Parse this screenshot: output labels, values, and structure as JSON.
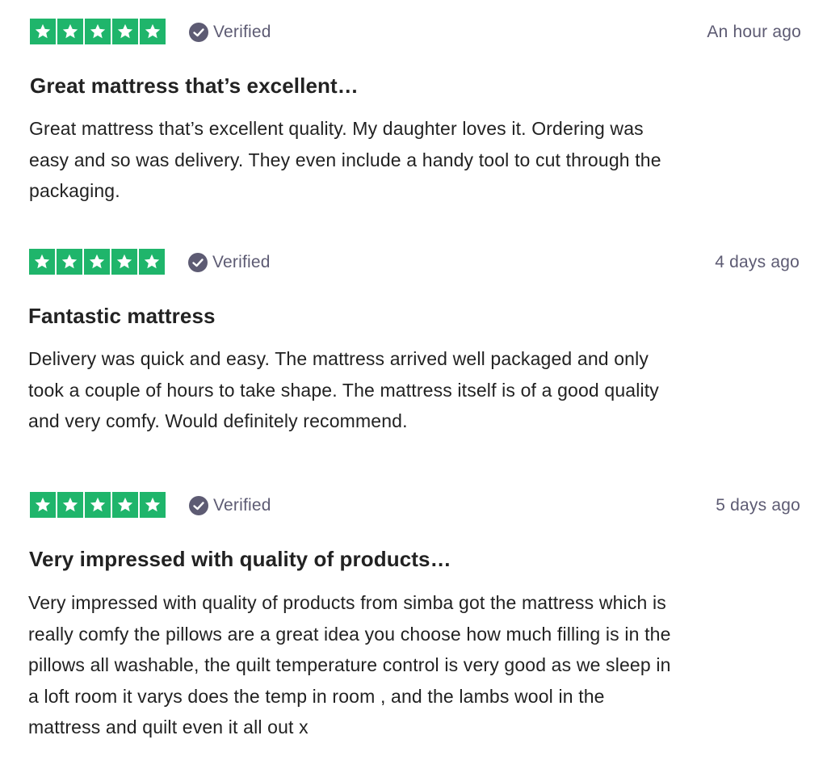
{
  "reviews": [
    {
      "rating": 5,
      "verified_label": "Verified",
      "time": "An hour ago",
      "title": "Great mattress that’s excellent…",
      "body_lines": [
        "Great mattress that’s excellent quality. My daughter loves it. Ordering was",
        "easy and so was delivery. They even include a handy tool to cut through the",
        "packaging."
      ]
    },
    {
      "rating": 5,
      "verified_label": "Verified",
      "time": "4 days ago",
      "title": "Fantastic mattress",
      "body_lines": [
        "Delivery was quick and easy. The mattress arrived well packaged and only",
        "took a couple of hours to take shape. The mattress itself is of a good quality",
        "and very comfy. Would definitely recommend."
      ]
    },
    {
      "rating": 5,
      "verified_label": "Verified",
      "time": "5 days ago",
      "title": "Very impressed with quality of products…",
      "body_lines": [
        "Very impressed with quality of products from simba got the mattress which is",
        "really comfy the pillows are a great idea you choose how much filling is in the",
        "pillows all washable, the quilt temperature control is very good as we sleep in",
        "a loft room it varys does the temp in room , and the lambs wool in the",
        "mattress and quilt even it all out x"
      ]
    }
  ],
  "colors": {
    "star_green": "#1fb56b",
    "verified_gray": "#5d5b73"
  },
  "icons": {
    "star": "star-icon",
    "verified": "verified-check-icon"
  }
}
